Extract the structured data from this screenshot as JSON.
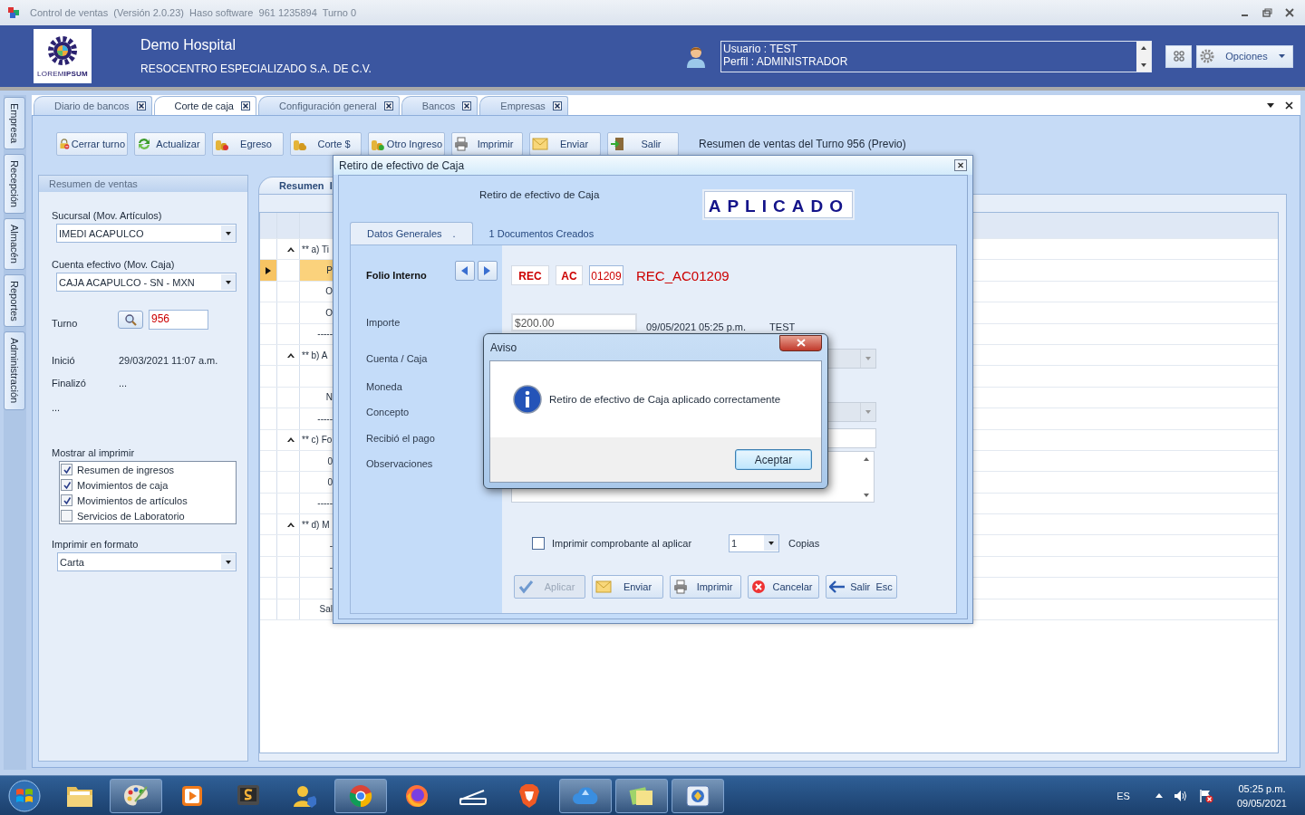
{
  "window": {
    "title": "Control de ventas  (Versión 2.0.23)  Haso software  961 1235894  Turno 0"
  },
  "header": {
    "logo_text": "LOREM**IPSUM**",
    "company": "Demo Hospital",
    "subtitle": "RESOCENTRO ESPECIALIZADO S.A. DE C.V.",
    "user_lines": [
      "Usuario : TEST",
      "Perfil : ADMINISTRADOR"
    ],
    "options": "Opciones"
  },
  "side_tabs": [
    "Empresa",
    "Recepción",
    "Almacén",
    "Reportes",
    "Administración"
  ],
  "tabs": [
    {
      "label": "Diario de bancos",
      "selected": false
    },
    {
      "label": "Corte de caja",
      "selected": true
    },
    {
      "label": "Configuración general",
      "selected": false
    },
    {
      "label": "Bancos",
      "selected": false
    },
    {
      "label": "Empresas",
      "selected": false
    }
  ],
  "toolbar": [
    "Cerrar turno",
    "Actualizar",
    "Egreso",
    "Corte $",
    "Otro Ingreso",
    "Imprimir",
    "Enviar",
    "Salir"
  ],
  "toolbar_note": "Resumen de ventas del Turno 956 (Previo)",
  "left_panel": {
    "title": "Resumen de ventas",
    "sucursal_label": "Sucursal (Mov. Artículos)",
    "sucursal": "IMEDI ACAPULCO",
    "cuenta_label": "Cuenta efectivo (Mov. Caja)",
    "cuenta": "CAJA ACAPULCO - SN - MXN",
    "turno_label": "Turno",
    "turno": "956",
    "inicio_label": "Inició",
    "inicio": "29/03/2021 11:07 a.m.",
    "fin_label": "Finalizó",
    "fin": "...",
    "extra": "...",
    "print_label": "Mostrar al imprimir",
    "print_options": [
      {
        "label": "Resumen de ingresos",
        "checked": true
      },
      {
        "label": "Movimientos de caja",
        "checked": true
      },
      {
        "label": "Movimientos de artículos",
        "checked": true
      },
      {
        "label": "Servicios de Laboratorio",
        "checked": false
      }
    ],
    "format_label": "Imprimir en formato",
    "format": "Carta"
  },
  "summary": {
    "tab": "Resumen  I",
    "rows": [
      {
        "kind": "group",
        "text": "** a) Ti",
        "expanded": true,
        "selected": false
      },
      {
        "kind": "row",
        "text": "P",
        "selected": true
      },
      {
        "kind": "row",
        "text": "O",
        "selected": false
      },
      {
        "kind": "row",
        "text": "O",
        "selected": false
      },
      {
        "kind": "row",
        "text": "-----",
        "selected": false
      },
      {
        "kind": "group",
        "text": "** b) A",
        "expanded": true,
        "selected": false
      },
      {
        "kind": "row",
        "selected": false
      },
      {
        "kind": "row",
        "text": "N",
        "selected": false
      },
      {
        "kind": "row",
        "text": "-----",
        "selected": false
      },
      {
        "kind": "group",
        "text": "** c) Fo",
        "expanded": true,
        "selected": false
      },
      {
        "kind": "row",
        "text": "0",
        "selected": false
      },
      {
        "kind": "row",
        "text": "0",
        "selected": false
      },
      {
        "kind": "row",
        "text": "-----",
        "selected": false
      },
      {
        "kind": "group",
        "text": "** d) M",
        "expanded": true,
        "selected": false
      },
      {
        "kind": "row",
        "text": "-",
        "selected": false
      },
      {
        "kind": "row",
        "text": "-",
        "selected": false
      },
      {
        "kind": "row",
        "text": "-",
        "selected": false
      },
      {
        "kind": "row",
        "text": "Sal",
        "selected": false
      }
    ]
  },
  "dialog": {
    "title": "Retiro de efectivo de Caja",
    "heading": "Retiro de efectivo de Caja",
    "status": "APLICADO",
    "tabs": [
      {
        "label": "Datos Generales",
        "suffix": ".",
        "selected": true
      },
      {
        "label": "1 Documentos Creados",
        "selected": false
      }
    ],
    "labels": [
      "Folio Interno",
      "Importe",
      "Cuenta / Caja",
      "Moneda",
      "Concepto",
      "Recibió el pago",
      "Observaciones"
    ],
    "folio_parts": [
      "REC",
      "AC",
      "01209"
    ],
    "folio": "REC_AC01209",
    "importe": "$200.00",
    "timestamp": "09/05/2021 05:25 p.m.",
    "user": "TEST",
    "print_checkbox": {
      "label": "Imprimir comprobante al aplicar",
      "checked": false
    },
    "copies": "1",
    "copies_label": "Copias",
    "buttons": [
      {
        "label": "Aplicar",
        "disabled": true
      },
      {
        "label": "Enviar",
        "disabled": false
      },
      {
        "label": "Imprimir",
        "disabled": false
      },
      {
        "label": "Cancelar",
        "disabled": false
      },
      {
        "label": "Salir  Esc",
        "disabled": false
      }
    ]
  },
  "message": {
    "title": "Aviso",
    "text": "Retiro de efectivo de Caja aplicado correctamente",
    "button": "Aceptar"
  },
  "taskbar": {
    "apps": [
      {
        "running": false
      },
      {
        "running": true
      },
      {
        "running": false
      },
      {
        "running": false
      },
      {
        "running": false
      },
      {
        "running": true
      },
      {
        "running": false
      },
      {
        "running": false
      },
      {
        "running": false
      },
      {
        "running": true
      },
      {
        "running": true
      },
      {
        "running": true
      }
    ],
    "lang": "ES",
    "time": "05:25 p.m.",
    "date": "09/05/2021"
  }
}
